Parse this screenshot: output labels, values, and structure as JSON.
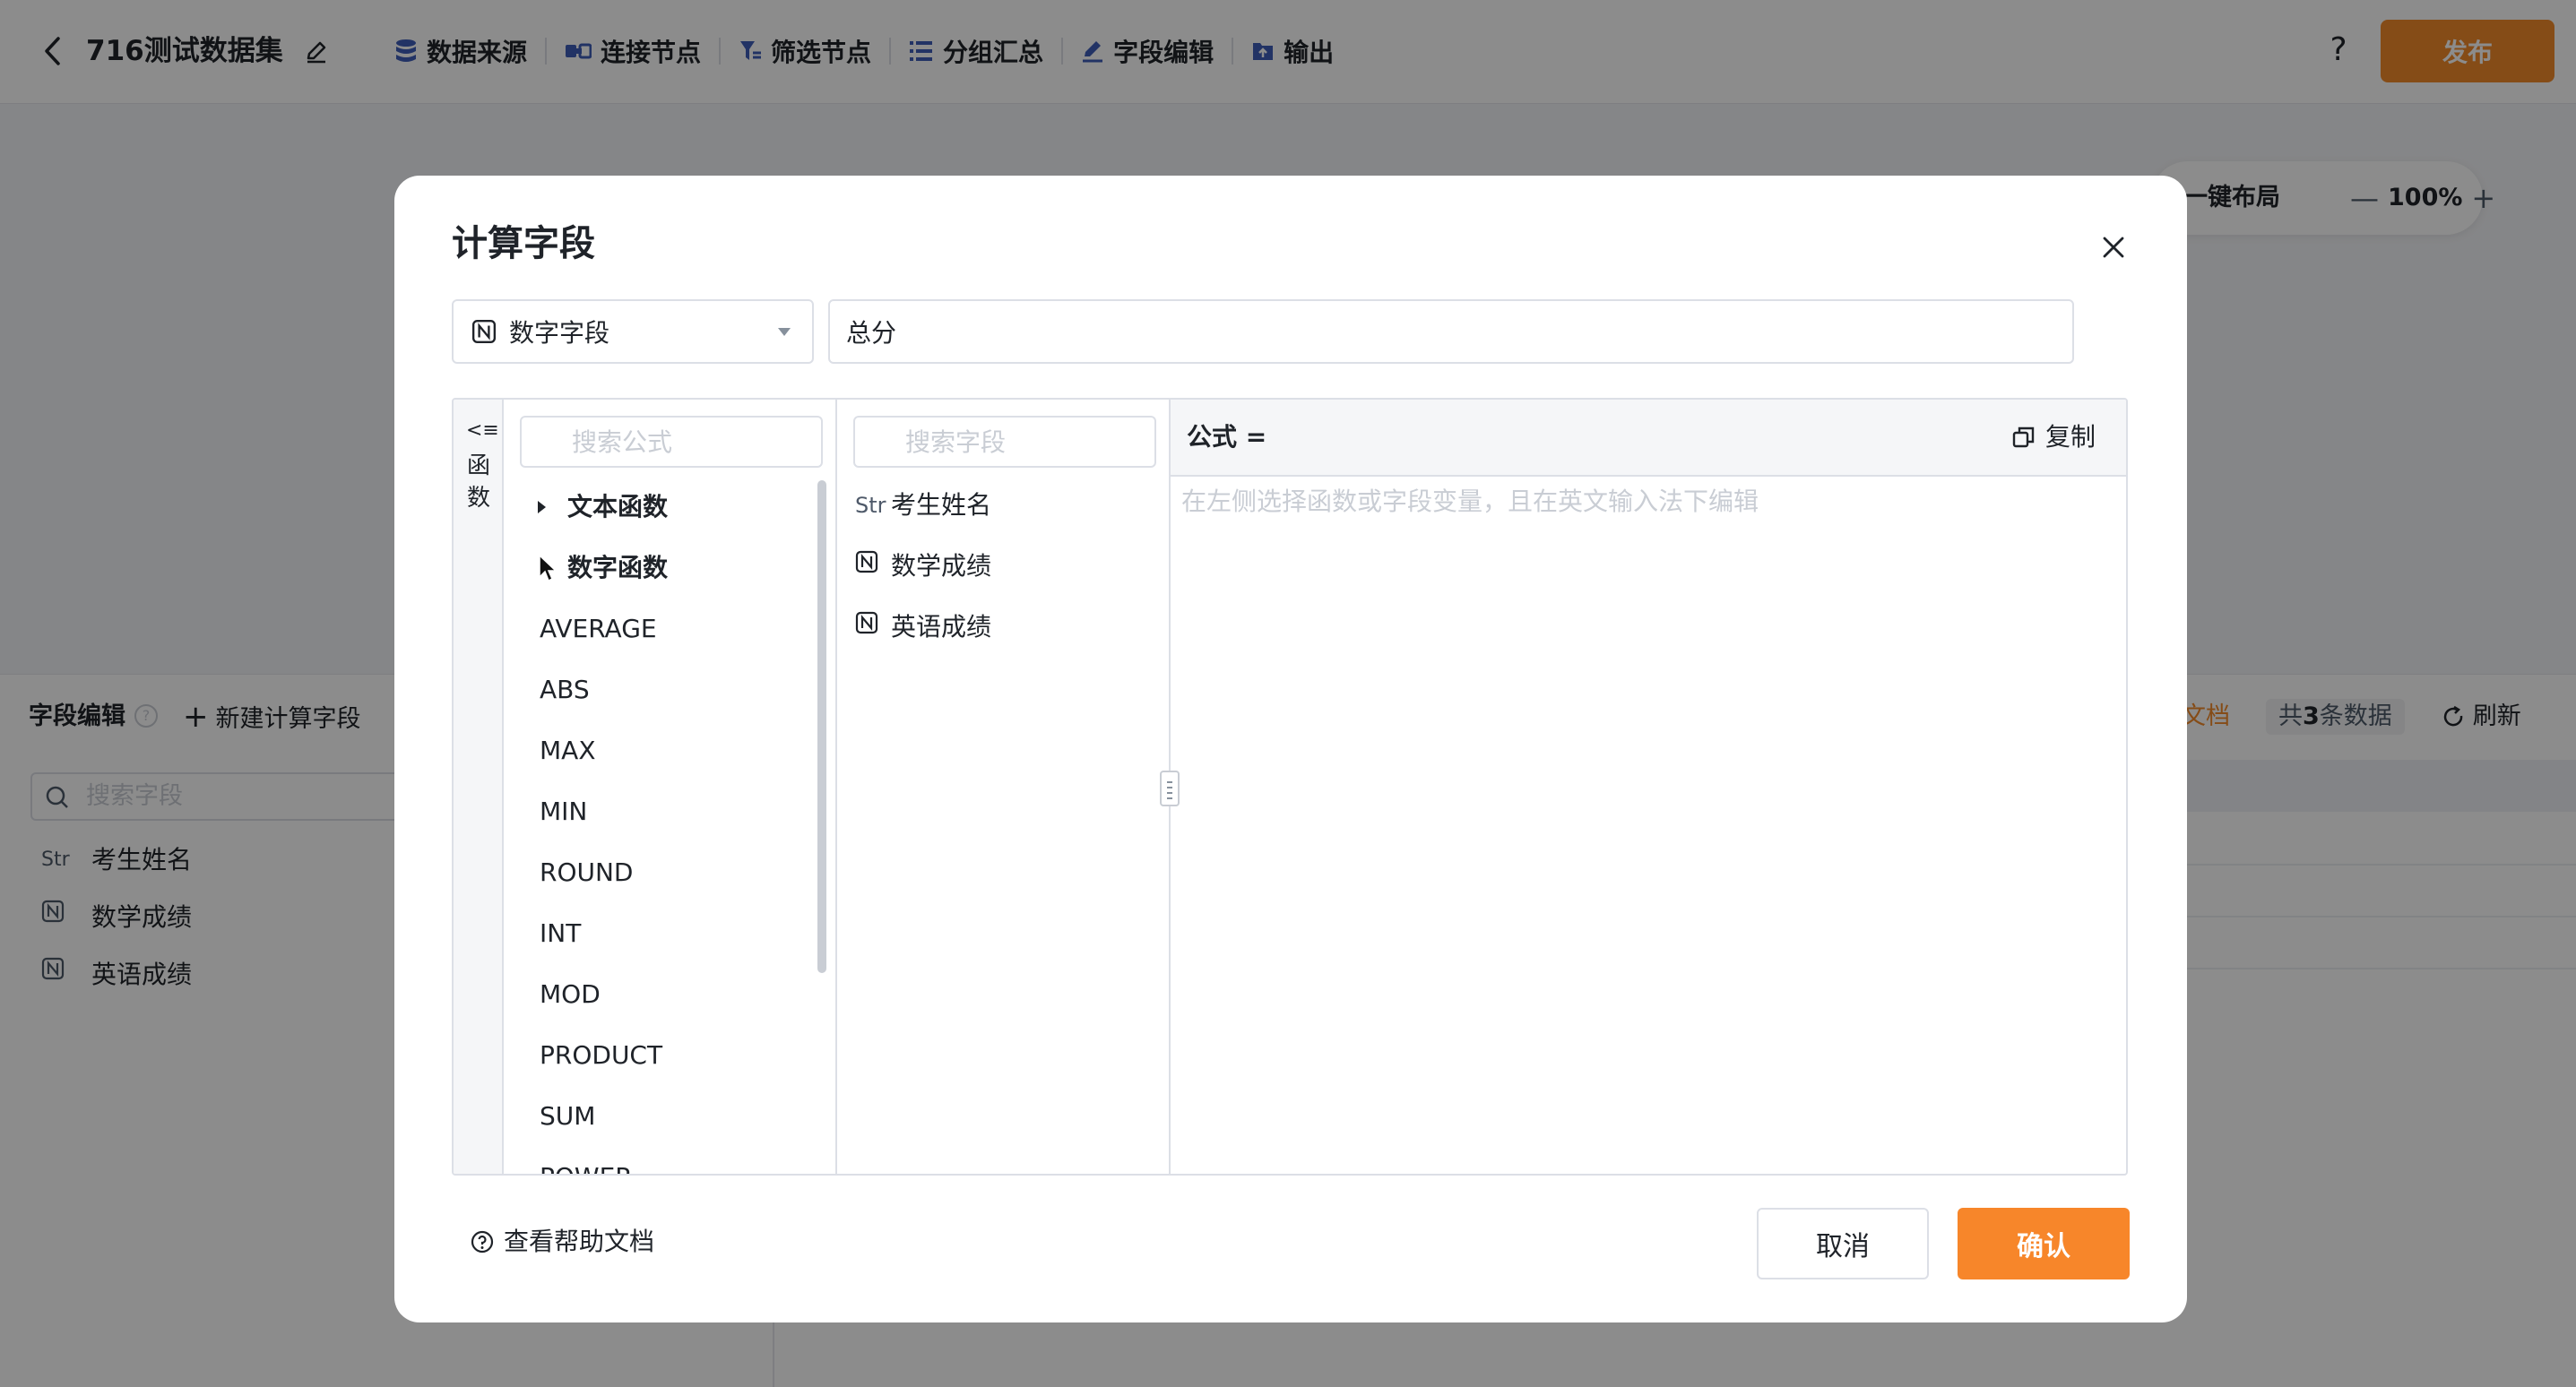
{
  "header": {
    "dataset_title": "716测试数据集",
    "nav": [
      {
        "label": "数据来源",
        "icon": "database-icon"
      },
      {
        "label": "连接节点",
        "icon": "join-icon"
      },
      {
        "label": "筛选节点",
        "icon": "filter-icon"
      },
      {
        "label": "分组汇总",
        "icon": "group-icon"
      },
      {
        "label": "字段编辑",
        "icon": "pen-icon"
      },
      {
        "label": "输出",
        "icon": "export-icon"
      }
    ],
    "help": "?",
    "publish": "发布",
    "accent": "#f28a2b"
  },
  "canvas_tools": {
    "layout": "一键布局",
    "zoom_minus": "—",
    "zoom": "100%",
    "zoom_plus": "+"
  },
  "bottom_panel": {
    "title": "字段编辑",
    "new_calc": "新建计算字段",
    "search_placeholder": "搜索字段",
    "fields": [
      {
        "tag": "Str",
        "name": "考生姓名"
      },
      {
        "tag": "N",
        "name": "数学成绩"
      },
      {
        "tag": "N",
        "name": "英语成绩"
      }
    ],
    "help_doc": "帮助文档",
    "count_prefix": "共",
    "count": "3",
    "count_suffix": "条数据",
    "refresh": "刷新"
  },
  "modal": {
    "title": "计算字段",
    "type_select": "数字字段",
    "field_name": "总分",
    "fn_toggle_arrow": "<≡",
    "fn_toggle_label": "函数",
    "fn_search_placeholder": "搜索公式",
    "fn_categories": [
      {
        "label": "文本函数",
        "expanded": false
      },
      {
        "label": "数字函数",
        "expanded": true
      }
    ],
    "functions": [
      "AVERAGE",
      "ABS",
      "MAX",
      "MIN",
      "ROUND",
      "INT",
      "MOD",
      "PRODUCT",
      "SUM",
      "POWER"
    ],
    "field_search_placeholder": "搜索字段",
    "fields": [
      {
        "tag": "Str",
        "name": "考生姓名"
      },
      {
        "tag": "N",
        "name": "数学成绩"
      },
      {
        "tag": "N",
        "name": "英语成绩"
      }
    ],
    "formula_label": "公式 =",
    "copy": "复制",
    "formula_hint": "在左侧选择函数或字段变量，且在英文输入法下编辑",
    "help_link": "查看帮助文档",
    "cancel": "取消",
    "confirm": "确认",
    "confirm_color": "#f7862a"
  }
}
